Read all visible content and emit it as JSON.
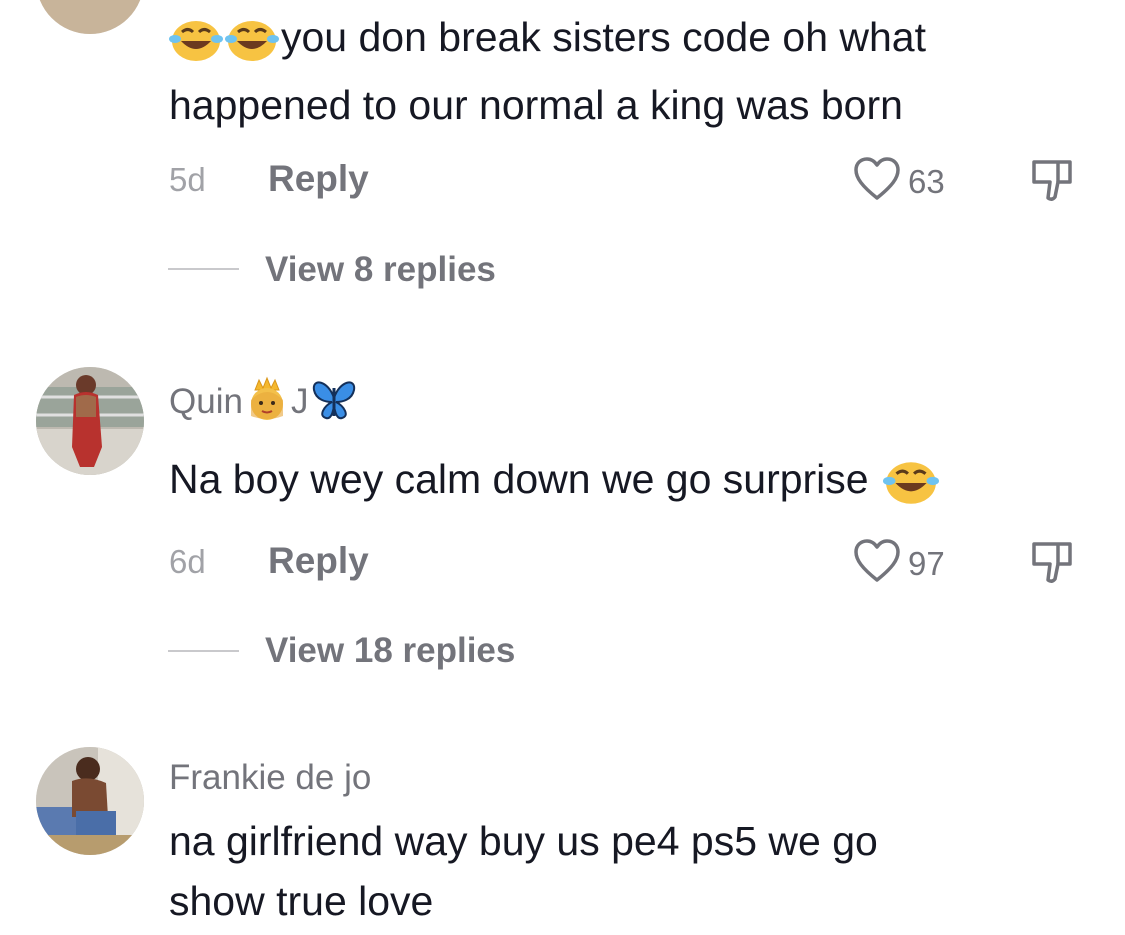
{
  "comments": [
    {
      "text_line1": "you don break sisters code oh what",
      "text_line2": "happened to our normal a king was born",
      "time": "5d",
      "reply_label": "Reply",
      "likes": "63",
      "view_replies": "View 8 replies"
    },
    {
      "username": "Quin",
      "username_suffix": "J",
      "text": "Na boy wey calm down we go surprise",
      "time": "6d",
      "reply_label": "Reply",
      "likes": "97",
      "view_replies": "View 18 replies"
    },
    {
      "username": "Frankie de jo",
      "text_line1": "na girlfriend way buy us pe4 ps5 we go",
      "text_line2": "show true love"
    }
  ],
  "icons": {
    "like": "heart-outline-icon",
    "dislike": "thumbs-down-outline-icon",
    "emoji_laugh": "face-with-tears-of-joy",
    "emoji_princess": "princess-crown",
    "emoji_butterfly": "blue-butterfly"
  },
  "colors": {
    "text_primary": "#161823",
    "text_secondary": "#73747b",
    "text_tertiary": "#a1a2a7",
    "divider": "#c9c9cc"
  }
}
